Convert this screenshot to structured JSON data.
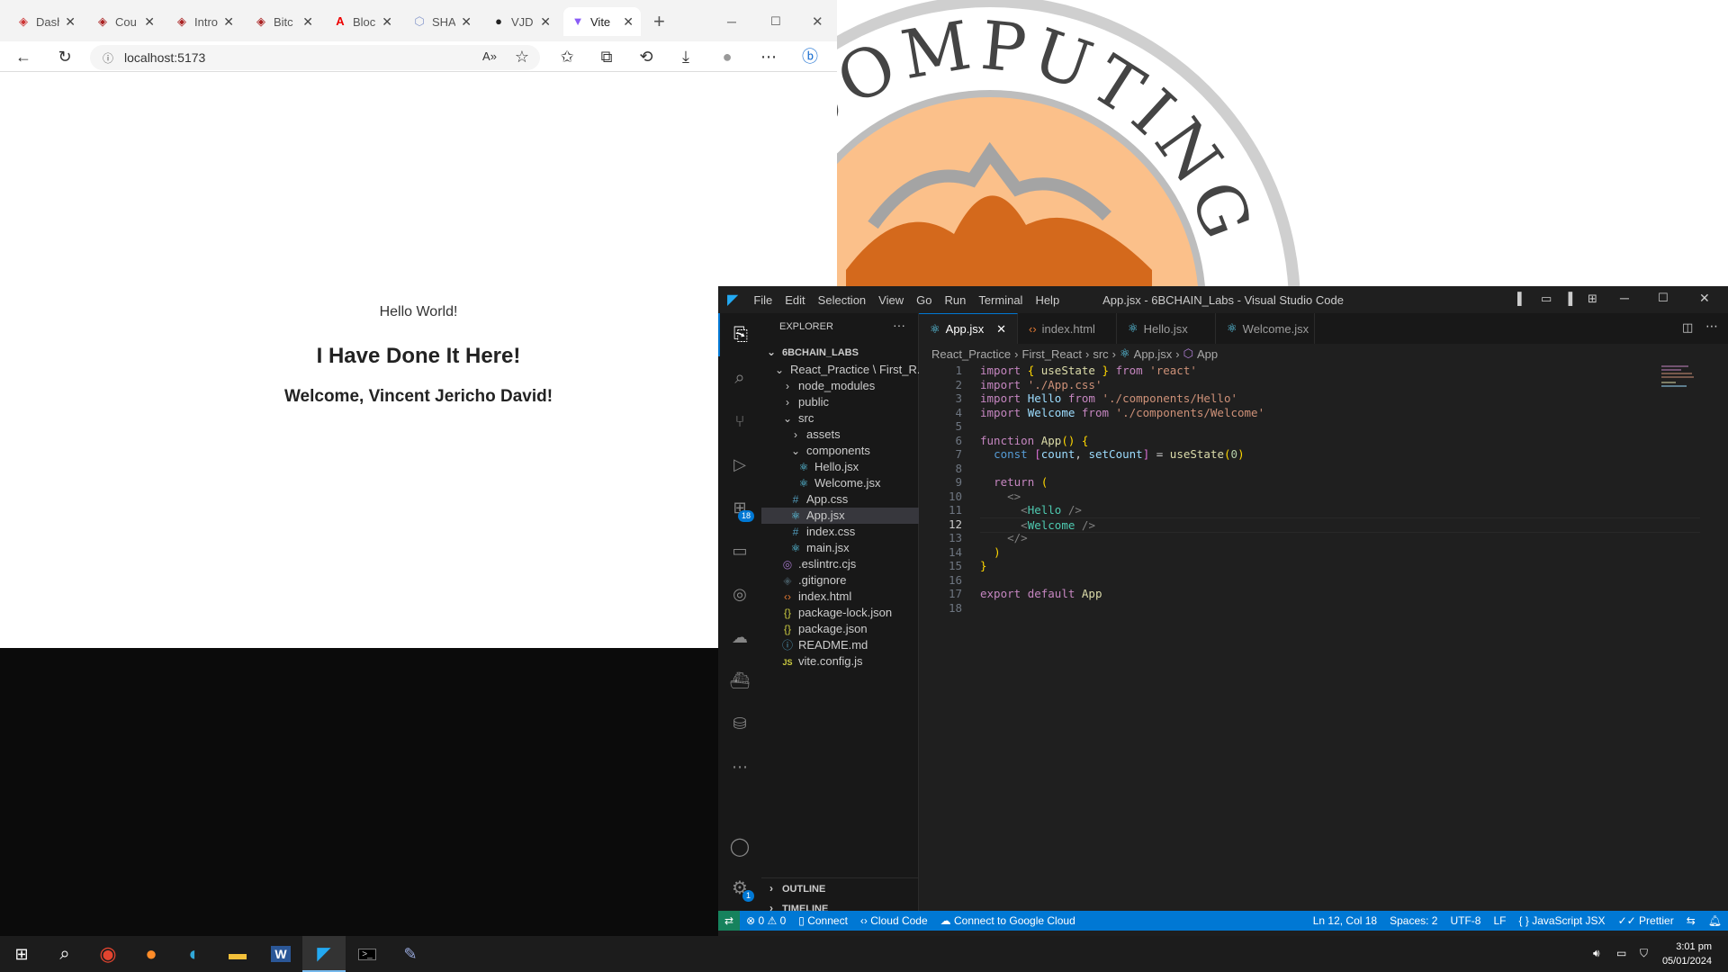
{
  "browser": {
    "tabs": [
      {
        "title": "Dash",
        "icon": "page-icon"
      },
      {
        "title": "Cou",
        "icon": "page-icon"
      },
      {
        "title": "Intro",
        "icon": "page-icon"
      },
      {
        "title": "Bitc",
        "icon": "page-icon"
      },
      {
        "title": "Bloc",
        "icon": "page-icon"
      },
      {
        "title": "SHA",
        "icon": "page-icon"
      },
      {
        "title": "VJD",
        "icon": "github-icon"
      },
      {
        "title": "Vite",
        "icon": "vite-icon"
      }
    ],
    "new_tab": "+",
    "url": "localhost:5173",
    "page": {
      "hello": "Hello World!",
      "heading": "I Have Done It Here!",
      "welcome": "Welcome, Vincent Jericho David!"
    }
  },
  "wallpaper": {
    "logo_text": "COMPUTING"
  },
  "vscode": {
    "menu": [
      "File",
      "Edit",
      "Selection",
      "View",
      "Go",
      "Run",
      "Terminal",
      "Help"
    ],
    "window_title": "App.jsx - 6BCHAIN_Labs - Visual Studio Code",
    "extensions_badge": "18",
    "settings_badge": "1",
    "explorer": {
      "title": "EXPLORER",
      "more": "···",
      "root": "6BCHAIN_LABS",
      "items": [
        {
          "label": "React_Practice \\ First_R...",
          "icon": "chevron-down",
          "indent": 1
        },
        {
          "label": "node_modules",
          "icon": "chevron-right",
          "indent": 2
        },
        {
          "label": "public",
          "icon": "chevron-right",
          "indent": 2
        },
        {
          "label": "src",
          "icon": "chevron-down",
          "indent": 2
        },
        {
          "label": "assets",
          "icon": "chevron-right",
          "indent": 3
        },
        {
          "label": "components",
          "icon": "chevron-down",
          "indent": 3
        },
        {
          "label": "Hello.jsx",
          "icon": "react",
          "indent": 4
        },
        {
          "label": "Welcome.jsx",
          "icon": "react",
          "indent": 4
        },
        {
          "label": "App.css",
          "icon": "css",
          "indent": 3
        },
        {
          "label": "App.jsx",
          "icon": "react",
          "indent": 3
        },
        {
          "label": "index.css",
          "icon": "css",
          "indent": 3
        },
        {
          "label": "main.jsx",
          "icon": "react",
          "indent": 3
        },
        {
          "label": ".eslintrc.cjs",
          "icon": "eslint",
          "indent": 2
        },
        {
          "label": ".gitignore",
          "icon": "git",
          "indent": 2
        },
        {
          "label": "index.html",
          "icon": "html",
          "indent": 2
        },
        {
          "label": "package-lock.json",
          "icon": "json",
          "indent": 2
        },
        {
          "label": "package.json",
          "icon": "json",
          "indent": 2
        },
        {
          "label": "README.md",
          "icon": "info",
          "indent": 2
        },
        {
          "label": "vite.config.js",
          "icon": "js",
          "indent": 2
        }
      ],
      "outline": "OUTLINE",
      "timeline": "TIMELINE"
    },
    "tabs": [
      "App.jsx",
      "index.html",
      "Hello.jsx",
      "Welcome.jsx"
    ],
    "breadcrumb": [
      "React_Practice",
      "First_React",
      "src",
      "App.jsx",
      "App"
    ],
    "code_lines": [
      "import { useState } from 'react'",
      "import './App.css'",
      "import Hello from './components/Hello'",
      "import Welcome from './components/Welcome'",
      "",
      "function App() {",
      "  const [count, setCount] = useState(0)",
      "",
      "  return (",
      "    <>",
      "      <Hello />",
      "      <Welcome />",
      "    </>",
      "  )",
      "}",
      "",
      "export default App",
      ""
    ],
    "current_line": 12,
    "status": {
      "errors": "0",
      "warnings": "0",
      "connect": "Connect",
      "cloud_code": "Cloud Code",
      "google_cloud": "Connect to Google Cloud",
      "position": "Ln 12, Col 18",
      "spaces": "Spaces: 2",
      "encoding": "UTF-8",
      "eol": "LF",
      "language": "JavaScript JSX",
      "prettier": "Prettier"
    }
  },
  "taskbar": {
    "time": "3:01 pm",
    "date": "05/01/2024"
  },
  "colors": {
    "vscode_accent": "#0078d4",
    "wallpaper_orange": "#d4691c",
    "wallpaper_peach": "#fbc08a"
  }
}
